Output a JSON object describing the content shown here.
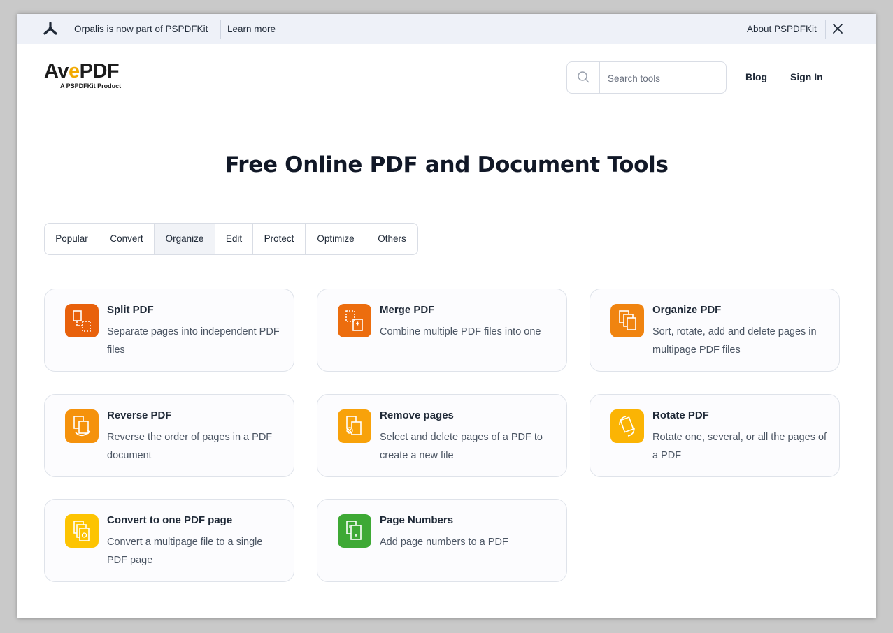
{
  "banner": {
    "message": "Orpalis is now part of PSPDFKit",
    "learn_more": "Learn more",
    "about": "About PSPDFKit"
  },
  "header": {
    "brand_name_pre": "Av",
    "brand_name_e": "e",
    "brand_name_post": "PDF",
    "brand_tagline": "A PSPDFKit Product",
    "search_placeholder": "Search tools",
    "blog": "Blog",
    "sign_in": "Sign In"
  },
  "main": {
    "title": "Free Online PDF and Document Tools",
    "tabs": [
      {
        "label": "Popular",
        "active": false
      },
      {
        "label": "Convert",
        "active": false
      },
      {
        "label": "Organize",
        "active": true
      },
      {
        "label": "Edit",
        "active": false
      },
      {
        "label": "Protect",
        "active": false
      },
      {
        "label": "Optimize",
        "active": false
      },
      {
        "label": "Others",
        "active": false
      }
    ],
    "tools": [
      {
        "title": "Split PDF",
        "description": "Separate pages into independent PDF files",
        "icon": "split-icon",
        "color": "#e8610c"
      },
      {
        "title": "Merge PDF",
        "description": "Combine multiple PDF files into one",
        "icon": "merge-icon",
        "color": "#ec6d0e"
      },
      {
        "title": "Organize PDF",
        "description": "Sort, rotate, add and delete pages in multipage PDF files",
        "icon": "organize-icon",
        "color": "#f08410"
      },
      {
        "title": "Reverse PDF",
        "description": "Reverse the order of pages in a PDF document",
        "icon": "reverse-icon",
        "color": "#f5920c"
      },
      {
        "title": "Remove pages",
        "description": "Select and delete pages of a PDF to create a new file",
        "icon": "remove-pages-icon",
        "color": "#f8a20a"
      },
      {
        "title": "Rotate PDF",
        "description": "Rotate one, several, or all the pages of a PDF",
        "icon": "rotate-icon",
        "color": "#fbb404"
      },
      {
        "title": "Convert to one PDF page",
        "description": "Convert a multipage file to a single PDF page",
        "icon": "one-page-icon",
        "color": "#fdc402"
      },
      {
        "title": "Page Numbers",
        "description": "Add page numbers to a PDF",
        "icon": "page-numbers-icon",
        "color": "#3ea935"
      }
    ]
  }
}
